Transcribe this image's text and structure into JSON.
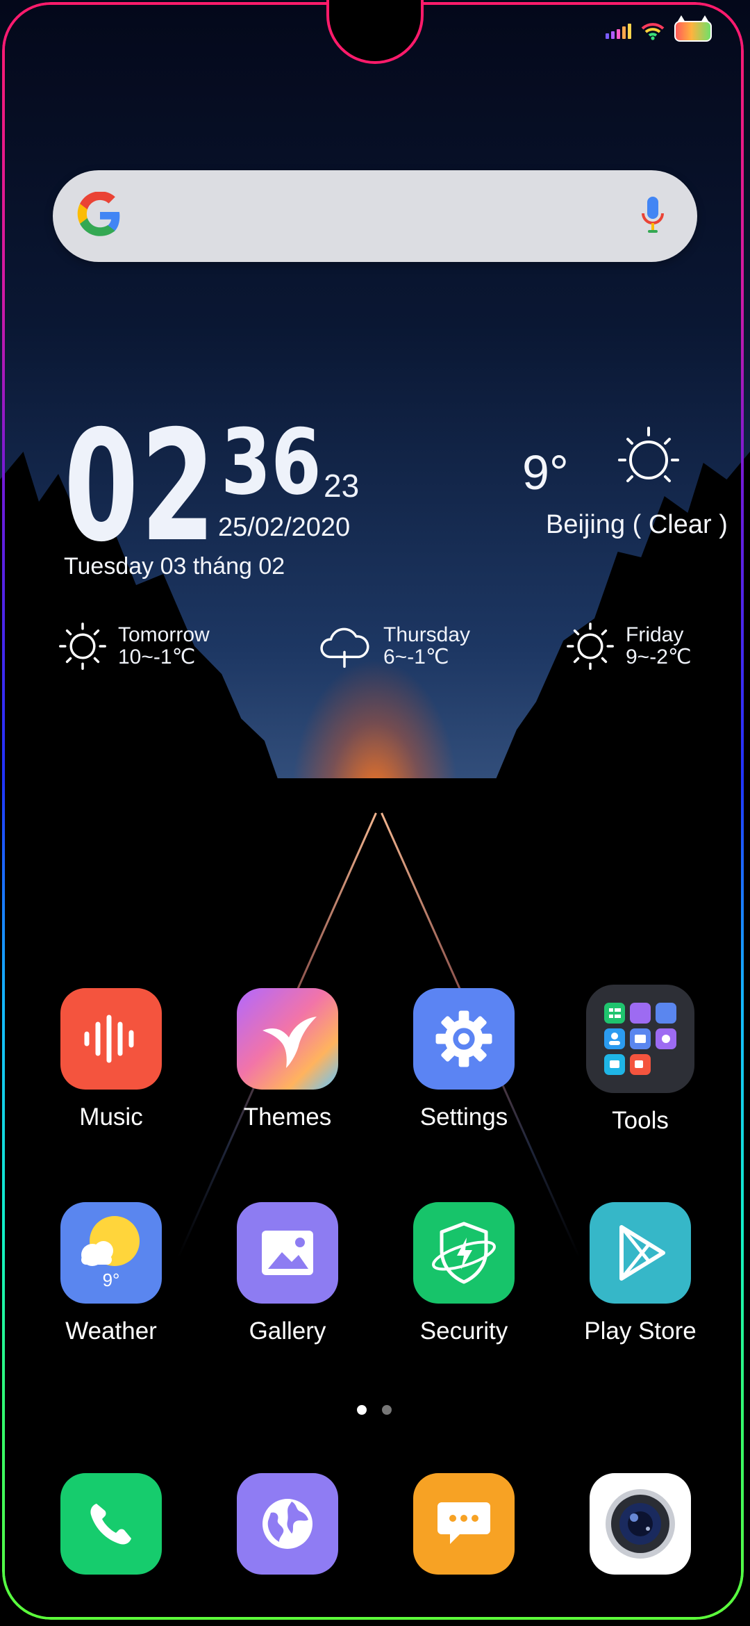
{
  "status_bar": {
    "signal_colors": [
      "#7b5cff",
      "#b25cff",
      "#ff5cc7",
      "#ffa84d",
      "#ffd54d"
    ],
    "wifi_colors": [
      "#ff3b5c",
      "#ffd23b",
      "#3be07a"
    ]
  },
  "search": {
    "engine_icon": "google-logo",
    "mic_icon": "mic-icon"
  },
  "clock": {
    "hour": "02",
    "minute": "36",
    "second": "23",
    "date": "25/02/2020",
    "lunar_date": "Tuesday 03 tháng 02"
  },
  "weather": {
    "temperature": "9°",
    "city": "Beijing ( Clear )",
    "condition_icon": "sun-icon",
    "forecast": [
      {
        "day": "Tomorrow",
        "range": "10~-1℃",
        "icon": "sun-icon"
      },
      {
        "day": "Thursday",
        "range": "6~-1℃",
        "icon": "rain-cloud-icon"
      },
      {
        "day": "Friday",
        "range": "9~-2℃",
        "icon": "sun-icon"
      }
    ]
  },
  "apps": [
    {
      "label": "Music",
      "color": "#f4543e"
    },
    {
      "label": "Themes",
      "color": "#9c6bf0"
    },
    {
      "label": "Settings",
      "color": "#5b84f3"
    },
    {
      "label": "Tools",
      "color": "#2d2f36"
    },
    {
      "label": "Weather",
      "color": "#5a86ef",
      "badge": "9°"
    },
    {
      "label": "Gallery",
      "color": "#8d7cf2"
    },
    {
      "label": "Security",
      "color": "#17c46a"
    },
    {
      "label": "Play Store",
      "color": "#36b7c8"
    }
  ],
  "page_indicator": {
    "current": 1,
    "total": 2
  },
  "dock": [
    {
      "name": "phone",
      "color": "#16cc6d"
    },
    {
      "name": "browser",
      "color": "#8f7cf3"
    },
    {
      "name": "messages",
      "color": "#f7a224"
    },
    {
      "name": "camera",
      "color": "#ffffff"
    }
  ]
}
